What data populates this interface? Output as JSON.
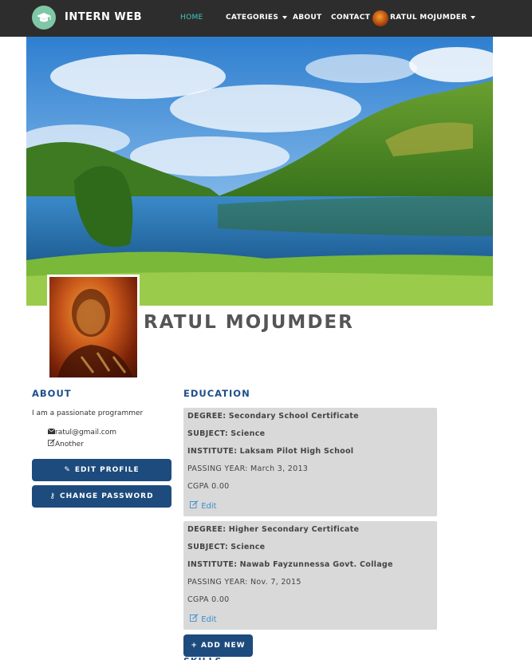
{
  "navbar": {
    "brand": "INTERN WEB",
    "brand_icon": "graduation-cap-icon",
    "links": {
      "home": "HOME",
      "categories": "CATEGORIES",
      "about": "ABOUT",
      "contact": "CONTACT",
      "user": "RATUL MOJUMDER"
    },
    "active": "home",
    "colors": {
      "bg": "#2d2d2d",
      "active": "#3fc6c0"
    }
  },
  "profile": {
    "name": "RATUL MOJUMDER"
  },
  "about": {
    "heading": "ABOUT",
    "bio": "I am a passionate programmer",
    "email": "ratul@gmail.com",
    "email_icon": "envelope-icon",
    "other": "Another",
    "other_icon": "edit-icon",
    "edit_profile": "EDIT PROFILE",
    "change_password": "CHANGE PASSWORD"
  },
  "education": {
    "heading": "EDUCATION",
    "entries": [
      {
        "degree_label": "DEGREE:",
        "degree": "Secondary School Certificate",
        "subject_label": "SUBJECT:",
        "subject": "Science",
        "institute_label": "INSTITUTE:",
        "institute": "Laksam Pilot High School",
        "passing_label": "PASSING YEAR:",
        "passing": "March 3, 2013",
        "cgpa_label": "CGPA",
        "cgpa": "0.00",
        "edit": "Edit"
      },
      {
        "degree_label": "DEGREE:",
        "degree": "Higher Secondary Certificate",
        "subject_label": "SUBJECT:",
        "subject": "Science",
        "institute_label": "INSTITUTE:",
        "institute": "Nawab Fayzunnessa Govt. Collage",
        "passing_label": "PASSING YEAR:",
        "passing": "Nov. 7, 2015",
        "cgpa_label": "CGPA",
        "cgpa": "0.00",
        "edit": "Edit"
      }
    ],
    "add_new": "ADD NEW"
  },
  "skills": {
    "heading": "SKILLS"
  },
  "colors": {
    "accent": "#1e4b7d",
    "heading": "#1f4e8a",
    "card_bg": "#d9d9d9",
    "link": "#3a8fc8"
  }
}
